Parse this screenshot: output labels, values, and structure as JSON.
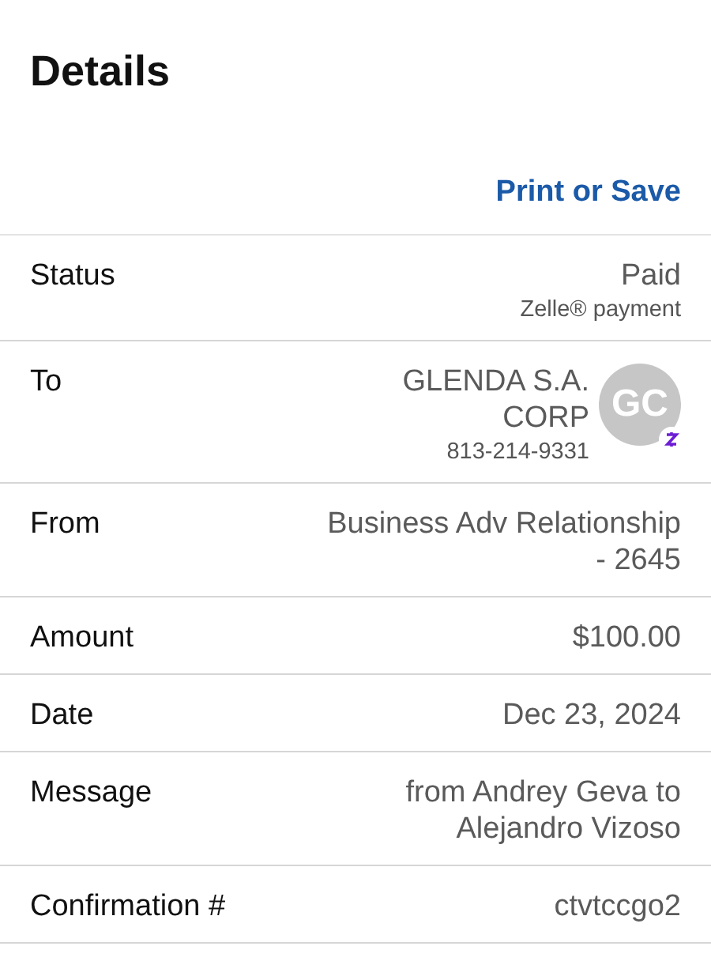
{
  "title": "Details",
  "print_link": "Print or Save",
  "rows": [
    {
      "label": "Status",
      "value": "Paid",
      "sub": "Zelle® payment"
    },
    {
      "label": "To",
      "value": "GLENDA S.A.\nCORP",
      "sub": "813-214-9331",
      "avatar": {
        "initials": "GC"
      }
    },
    {
      "label": "From",
      "value": "Business Adv Relationship\n- 2645"
    },
    {
      "label": "Amount",
      "value": "$100.00"
    },
    {
      "label": "Date",
      "value": "Dec 23, 2024"
    },
    {
      "label": "Message",
      "value": "from Andrey Geva to\nAlejandro Vizoso"
    },
    {
      "label": "Confirmation #",
      "value": "ctvtccgo2"
    }
  ]
}
